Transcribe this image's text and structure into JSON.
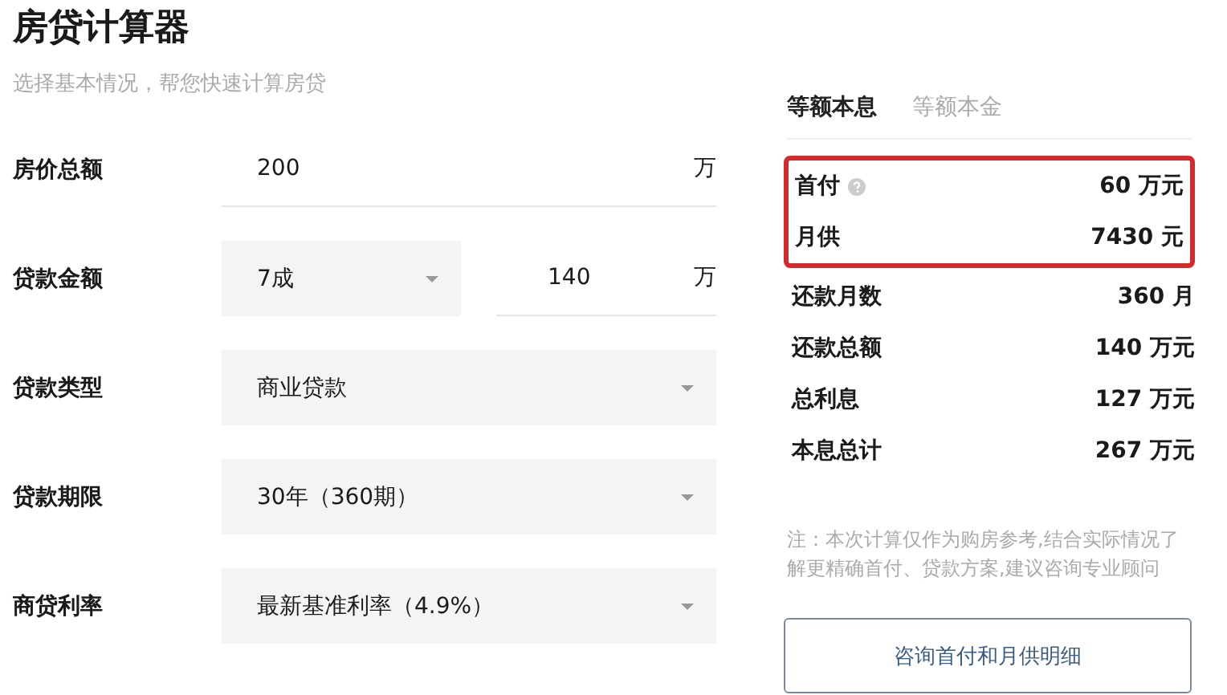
{
  "title": "房贷计算器",
  "subtitle": "选择基本情况，帮您快速计算房贷",
  "form": [
    {
      "kind": "input",
      "label": "房价总额",
      "value": "200",
      "unit": "万"
    },
    {
      "kind": "select_input",
      "label": "贷款金额",
      "select": "7成",
      "value": "140",
      "unit": "万"
    },
    {
      "kind": "select",
      "label": "贷款类型",
      "value": "商业贷款"
    },
    {
      "kind": "select",
      "label": "贷款期限",
      "value": "30年（360期）"
    },
    {
      "kind": "select",
      "label": "商贷利率",
      "value": "最新基准利率（4.9%）"
    }
  ],
  "tabs": [
    {
      "label": "等额本息",
      "selected": true
    },
    {
      "label": "等额本金",
      "selected": false
    }
  ],
  "results": [
    {
      "label": "首付",
      "value": "60 万元",
      "help": true,
      "highlighted": true
    },
    {
      "label": "月供",
      "value": "7430 元",
      "help": false,
      "highlighted": true
    },
    {
      "label": "还款月数",
      "value": "360 月",
      "help": false,
      "highlighted": false
    },
    {
      "label": "还款总额",
      "value": "140 万元",
      "help": false,
      "highlighted": false
    },
    {
      "label": "总利息",
      "value": "127 万元",
      "help": false,
      "highlighted": false
    },
    {
      "label": "本息总计",
      "value": "267 万元",
      "help": false,
      "highlighted": false
    }
  ],
  "note": "注：本次计算仅作为购房参考,结合实际情况了解更精确首付、贷款方案,建议咨询专业顾问",
  "button": "咨询首付和月供明细"
}
